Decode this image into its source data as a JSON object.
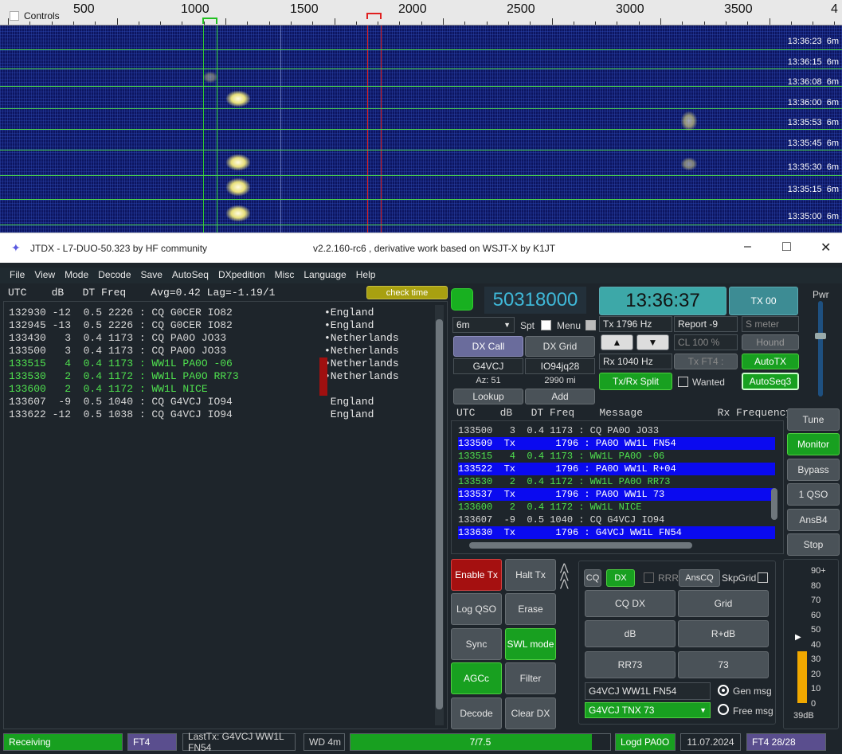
{
  "waterfall": {
    "controls_label": "Controls",
    "scale": [
      "500",
      "1000",
      "1500",
      "2000",
      "2500",
      "3000",
      "3500",
      "4"
    ],
    "timestamps": [
      "13:36:23",
      "13:36:15",
      "13:36:08",
      "13:36:00",
      "13:35:53",
      "13:35:45",
      "13:35:30",
      "13:35:15",
      "13:35:00"
    ],
    "band": "6m"
  },
  "window": {
    "title": "JTDX - L7-DUO-50.323  by HF community",
    "subtitle": "v2.2.160-rc6 , derivative work based on WSJT-X by K1JT",
    "minimize": "–",
    "maximize": "□",
    "close": "✕"
  },
  "menu": [
    "File",
    "View",
    "Mode",
    "Decode",
    "Save",
    "AutoSeq",
    "DXpedition",
    "Misc",
    "Language",
    "Help"
  ],
  "band_activity": {
    "header": "UTC    dB   DT Freq    Avg=0.42 Lag=-1.19/1",
    "check_time": "check time",
    "rows": [
      {
        "text": "132930 -12  0.5 2226 : CQ G0CER IO82",
        "country": "•England",
        "style": "normal"
      },
      {
        "text": "132945 -13  0.5 2226 : CQ G0CER IO82",
        "country": "•England",
        "style": "normal"
      },
      {
        "text": "133430   3  0.4 1173 : CQ PA0O JO33",
        "country": "•Netherlands",
        "style": "normal"
      },
      {
        "text": "133500   3  0.4 1173 : CQ PA0O JO33",
        "country": "•Netherlands",
        "style": "normal"
      },
      {
        "text": "133515   4  0.4 1173 : WW1L PA0O -06",
        "country": "•Netherlands",
        "style": "green"
      },
      {
        "text": "133530   2  0.4 1172 : WW1L PA0O RR73",
        "country": "•Netherlands",
        "style": "green"
      },
      {
        "text": "133600   2  0.4 1172 : WW1L NICE",
        "country": "",
        "style": "green"
      },
      {
        "text": "133607  -9  0.5 1040 : CQ G4VCJ IO94",
        "country": " England",
        "style": "normal"
      },
      {
        "text": "133622 -12  0.5 1038 : CQ G4VCJ IO94",
        "country": " England",
        "style": "normal"
      }
    ]
  },
  "controls": {
    "frequency": "50318000",
    "clock": "13:36:37",
    "tx00": "TX 00",
    "pwr": "Pwr",
    "band": "6m",
    "spt": "Spt",
    "menu_label": "Menu",
    "tx_freq": "Tx  1796  Hz",
    "report": "Report -9",
    "smeter": "S meter",
    "dx_call_btn": "DX Call",
    "dx_grid_btn": "DX Grid",
    "dx_call": "G4VCJ",
    "dx_grid": "IO94jq28",
    "az": "Az: 51",
    "dist": "2990 mi",
    "lookup": "Lookup",
    "add": "Add",
    "up": "▲",
    "down": "▼",
    "cl": "CL  100 %",
    "hound": "Hound",
    "rx_freq": "Rx  1040  Hz",
    "txft4": "Tx FT4 :",
    "autotx": "AutoTX",
    "split": "Tx/Rx Split",
    "wanted": "Wanted",
    "autoseq": "AutoSeq3"
  },
  "rx_freq_list": {
    "header": "UTC    dB   DT Freq    Message            Rx Frequency",
    "rows": [
      {
        "text": "133500   3  0.4 1173 : CQ PA0O JO33",
        "style": "normal"
      },
      {
        "text": "133509  Tx       1796 : PA0O WW1L FN54",
        "style": "tx"
      },
      {
        "text": "133515   4  0.4 1173 : WW1L PA0O -06",
        "style": "green"
      },
      {
        "text": "133522  Tx       1796 : PA0O WW1L R+04",
        "style": "tx"
      },
      {
        "text": "133530   2  0.4 1172 : WW1L PA0O RR73",
        "style": "green"
      },
      {
        "text": "133537  Tx       1796 : PA0O WW1L 73",
        "style": "tx"
      },
      {
        "text": "133600   2  0.4 1172 : WW1L NICE",
        "style": "green"
      },
      {
        "text": "133607  -9  0.5 1040 : CQ G4VCJ IO94",
        "style": "normal"
      },
      {
        "text": "133630  Tx       1796 : G4VCJ WW1L FN54",
        "style": "tx"
      }
    ]
  },
  "side_buttons": [
    "Tune",
    "Monitor",
    "Bypass",
    "1 QSO",
    "AnsB4",
    "Stop"
  ],
  "action_buttons": {
    "enable_tx": "Enable Tx",
    "halt_tx": "Halt Tx",
    "log_qso": "Log QSO",
    "erase": "Erase",
    "sync": "Sync",
    "swl": "SWL mode",
    "agcc": "AGCc",
    "filter": "Filter",
    "decode": "Decode",
    "clear_dx": "Clear DX"
  },
  "messages": {
    "cq": "CQ",
    "dx": "DX",
    "rrr": "RRR",
    "anscq": "AnsCQ",
    "skpgrid": "SkpGrid",
    "buttons": [
      "CQ DX",
      "Grid",
      "dB",
      "R+dB",
      "RR73",
      "73"
    ],
    "msg1": "G4VCJ WW1L FN54",
    "msg2": "G4VCJ TNX 73",
    "gen_msg": "Gen msg",
    "free_msg": "Free msg"
  },
  "meter": {
    "labels": [
      "90+",
      "80",
      "70",
      "60",
      "50",
      "40",
      "30",
      "20",
      "10",
      "0"
    ],
    "reading": "39dB",
    "level": 0.39
  },
  "status_bar": {
    "state": "Receiving",
    "mode": "FT4",
    "last_tx": "LastTx: G4VCJ WW1L FN54",
    "wd": "WD 4m",
    "progress": "7/7.5",
    "progress_frac": 0.93,
    "logd": "Logd PA0O",
    "date": "11.07.2024",
    "count": "FT4  28/28"
  },
  "colors": {
    "accent_green": "#18a020",
    "tx_blue": "#0a0af0",
    "freq_cyan": "#3fb8d8"
  }
}
